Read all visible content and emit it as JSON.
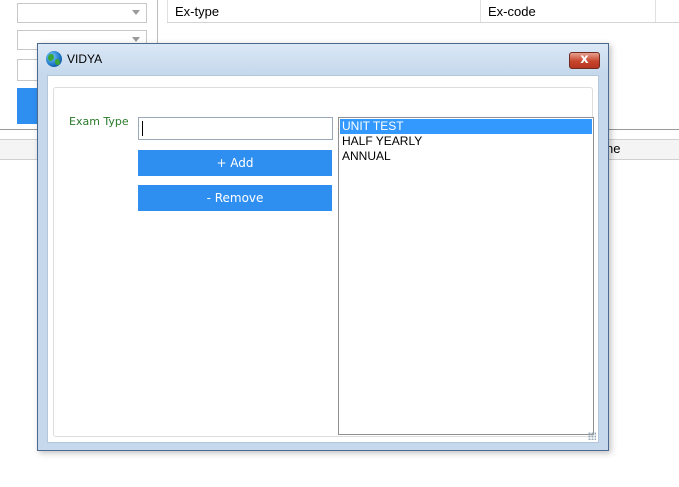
{
  "background": {
    "grid": {
      "columns": [
        "Ex-type",
        "Ex-code"
      ]
    },
    "lower_grid": {
      "partial_column": "ne"
    }
  },
  "dialog": {
    "title": "VIDYA",
    "title_icon": "globe-icon",
    "close_icon": "close-icon",
    "close_glyph": "x",
    "exam_type_label": "Exam Type",
    "exam_type_value": "",
    "add_label": "+ Add",
    "remove_label": "- Remove",
    "exam_types": [
      "UNIT TEST",
      "HALF YEARLY",
      "ANNUAL"
    ],
    "selected_exam_type": "UNIT TEST"
  },
  "colors": {
    "button_blue": "#2f8ff0",
    "selection_blue": "#3399ff",
    "label_green": "#2a7a2a",
    "window_frame": "#c5d8ec",
    "close_red": "#c8442c"
  }
}
